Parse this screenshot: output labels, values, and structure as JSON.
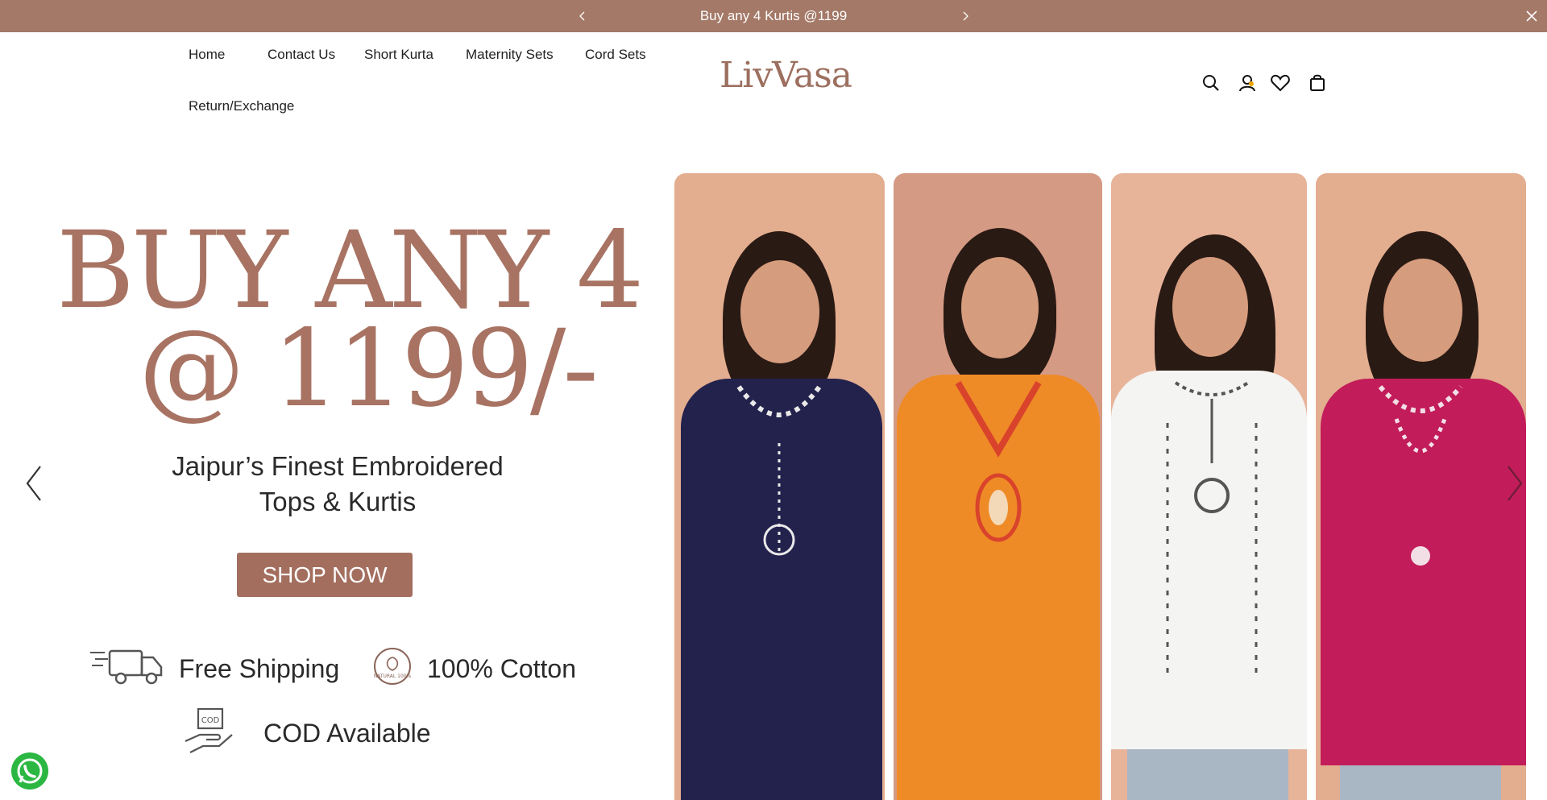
{
  "announcement": {
    "text": "Buy any 4 Kurtis @1199",
    "prev_icon": "chevron-left-icon",
    "next_icon": "chevron-right-icon",
    "close_icon": "close-icon"
  },
  "colors": {
    "brand": "#a47968",
    "headline": "#a87363",
    "button": "#a36e5e",
    "whatsapp": "#2bb741"
  },
  "nav": {
    "items": [
      "Home",
      "Contact Us",
      "Short Kurta",
      "Maternity Sets",
      "Cord Sets",
      "Return/Exchange"
    ]
  },
  "logo": {
    "text": "LivVasa"
  },
  "header_icons": [
    "search-icon",
    "account-icon",
    "wishlist-heart-icon",
    "cart-bag-icon"
  ],
  "hero": {
    "headline_line1": "BUY ANY 4",
    "headline_line2": "@ 1199/-",
    "subheading_line1": "Jaipur’s Finest Embroidered",
    "subheading_line2": "Tops & Kurtis",
    "cta": "SHOP NOW",
    "features": [
      {
        "icon": "delivery-truck-icon",
        "label": "Free Shipping"
      },
      {
        "icon": "natural-leaf-badge-icon",
        "label": "100% Cotton"
      },
      {
        "icon": "cod-hand-icon",
        "label": "COD Available"
      }
    ],
    "natural_badge_text": "NATURAL 100%",
    "products": [
      {
        "color": "navy",
        "hex": "#23224d"
      },
      {
        "color": "orange",
        "hex": "#ef8b27"
      },
      {
        "color": "white",
        "hex": "#f4f4f2"
      },
      {
        "color": "magenta",
        "hex": "#c21c5a"
      }
    ],
    "prev_icon": "slider-prev-icon",
    "next_icon": "slider-next-icon"
  },
  "chat": {
    "icon": "whatsapp-icon"
  }
}
